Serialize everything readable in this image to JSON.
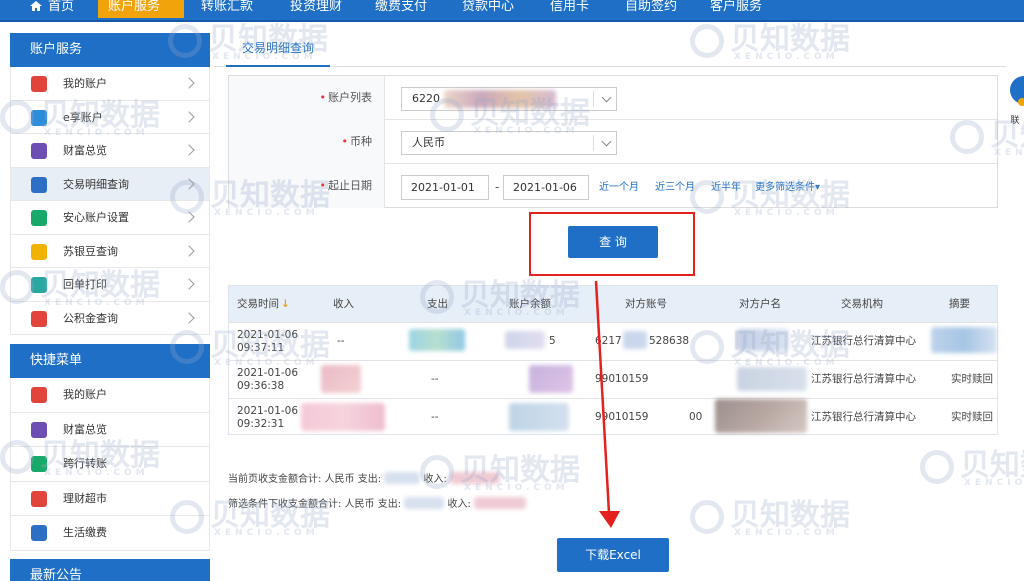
{
  "nav": {
    "home": "首页",
    "items": [
      "账户服务",
      "转账汇款",
      "投资理财",
      "缴费支付",
      "贷款中心",
      "信用卡",
      "自助签约",
      "客户服务"
    ],
    "active_index": 0
  },
  "sidebar": {
    "account_title": "账户服务",
    "account_items": [
      {
        "label": "我的账户",
        "icon": "card-icon",
        "color": "#e0443a"
      },
      {
        "label": "e享账户",
        "icon": "e-account-icon",
        "color": "#2e8ddb"
      },
      {
        "label": "财富总览",
        "icon": "pie-chart-icon",
        "color": "#6d4fb4"
      },
      {
        "label": "交易明细查询",
        "icon": "yen-doc-icon",
        "color": "#2e6fc6"
      },
      {
        "label": "安心账户设置",
        "icon": "shield-icon",
        "color": "#17a96a"
      },
      {
        "label": "苏银豆查询",
        "icon": "search-coin-icon",
        "color": "#f0b400"
      },
      {
        "label": "回单打印",
        "icon": "printer-icon",
        "color": "#2aa7a0"
      },
      {
        "label": "公积金查询",
        "icon": "building-icon",
        "color": "#e0443a"
      }
    ],
    "selected_index": 3,
    "shortcut_title": "快捷菜单",
    "shortcut_items": [
      {
        "label": "我的账户",
        "icon": "card-icon",
        "color": "#e0443a"
      },
      {
        "label": "财富总览",
        "icon": "pie-chart-icon",
        "color": "#6d4fb4"
      },
      {
        "label": "跨行转账",
        "icon": "transfer-icon",
        "color": "#17a96a"
      },
      {
        "label": "理财超市",
        "icon": "chart-icon",
        "color": "#e0443a"
      },
      {
        "label": "生活缴费",
        "icon": "bill-icon",
        "color": "#2e6fc6"
      }
    ],
    "news_title": "最新公告"
  },
  "main": {
    "tab": "交易明细查询",
    "form": {
      "account_label": "账户列表",
      "account_value": "6220",
      "currency_label": "币种",
      "currency_value": "人民币",
      "date_label": "起止日期",
      "date_start": "2021-01-01",
      "date_sep": "-",
      "date_end": "2021-01-06",
      "quick_links": [
        "近一个月",
        "近三个月",
        "近半年"
      ],
      "more_filter": "更多筛选条件▾"
    },
    "query_button": "查 询",
    "table": {
      "headers": [
        "交易时间",
        "收入",
        "支出",
        "账户余额",
        "对方账号",
        "对方户名",
        "交易机构",
        "摘要"
      ],
      "rows": [
        {
          "date": "2021-01-06",
          "time": "09:37:11",
          "income": "--",
          "expense": "",
          "balance": "5",
          "account": "6217",
          "account2": "528638",
          "institution": "江苏银行总行清算中心",
          "memo": ""
        },
        {
          "date": "2021-01-06",
          "time": "09:36:38",
          "income": "",
          "expense": "--",
          "balance": "",
          "account": "99010159",
          "account2": "",
          "institution": "江苏银行总行清算中心",
          "memo": "实时赎回"
        },
        {
          "date": "2021-01-06",
          "time": "09:32:31",
          "income": "",
          "expense": "--",
          "balance": "",
          "account": "99010159",
          "account2": "00",
          "institution": "江苏银行总行清算中心",
          "memo": "实时赎回"
        }
      ]
    },
    "summary_page": "当前页收支金额合计: 人民币 支出:",
    "summary_page_income": "收入:",
    "summary_filter": "筛选条件下收支金额合计: 人民币 支出:",
    "summary_filter_income": "收入:",
    "excel_button": "下载Excel"
  },
  "watermark": {
    "brand": "贝知数据",
    "domain": "XENCIO.COM"
  },
  "right_float_label": "联"
}
